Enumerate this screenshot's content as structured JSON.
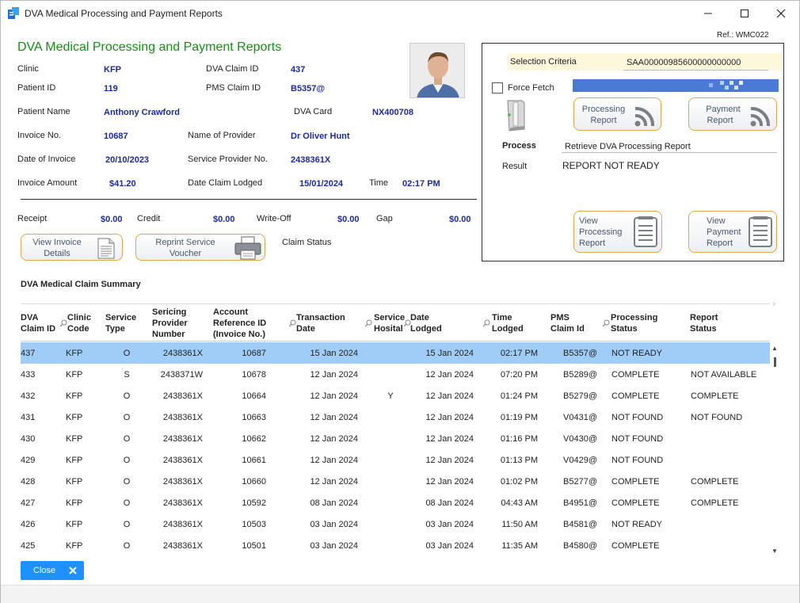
{
  "window": {
    "title": "DVA  Medical Processing and Payment Reports"
  },
  "header": {
    "title": "DVA  Medical Processing and Payment Reports",
    "ref": "Ref.: WMC022"
  },
  "claim": {
    "clinic_label": "Clinic",
    "clinic": "KFP",
    "dva_claim_id_label": "DVA Claim ID",
    "dva_claim_id": "437",
    "patient_id_label": "Patient ID",
    "patient_id": "119",
    "pms_claim_id_label": "PMS Claim ID",
    "pms_claim_id": "B5357@",
    "patient_name_label": "Patient Name",
    "patient_name": "Anthony Crawford",
    "dva_card_label": "DVA Card",
    "dva_card": "NX400708",
    "invoice_no_label": "Invoice No.",
    "invoice_no": "10687",
    "provider_name_label": "Name of Provider",
    "provider_name": "Dr Oliver Hunt",
    "date_of_invoice_label": "Date of Invoice",
    "date_of_invoice": "20/10/2023",
    "service_provider_no_label": "Service Provider No.",
    "service_provider_no": "2438361X",
    "invoice_amount_label": "Invoice Amount",
    "invoice_amount": "$41.20",
    "date_claim_lodged_label": "Date Claim Lodged",
    "date_claim_lodged": "15/01/2024",
    "time_label": "Time",
    "time": "02:17 PM"
  },
  "totals": {
    "receipt_label": "Receipt",
    "receipt": "$0.00",
    "credit_label": "Credit",
    "credit": "$0.00",
    "writeoff_label": "Write-Off",
    "writeoff": "$0.00",
    "gap_label": "Gap",
    "gap": "$0.00"
  },
  "buttons": {
    "view_invoice_1": "View Invoice",
    "view_invoice_2": "Details",
    "reprint_1": "Reprint Service",
    "reprint_2": "Voucher",
    "claim_status": "Claim Status",
    "processing_report_1": "Processing",
    "processing_report_2": "Report",
    "payment_report_1": "Payment",
    "payment_report_2": "Report",
    "view_processing_1": "View",
    "view_processing_2": "Processing",
    "view_processing_3": "Report",
    "view_payment_1": "View",
    "view_payment_2": "Payment",
    "view_payment_3": "Report",
    "close": "Close"
  },
  "panel": {
    "selection_criteria_label": "Selection Criteria",
    "selection_criteria": "SAA00000985600000000000",
    "force_fetch": "Force Fetch",
    "process_label": "Process",
    "process": "Retrieve DVA Processing Report",
    "result_label": "Result",
    "result": "REPORT NOT READY"
  },
  "summary": {
    "title": "DVA Medical Claim Summary",
    "columns": [
      [
        "DVA",
        "Claim ID"
      ],
      [
        "Clinic",
        "Code"
      ],
      [
        "Service",
        "Type"
      ],
      [
        "Sericing",
        "Provider",
        "Number"
      ],
      [
        "Account",
        "Reference ID",
        "(Invoice No.)"
      ],
      [
        "Transaction",
        "Date"
      ],
      [
        "Service",
        "Hosital"
      ],
      [
        "Date",
        "Lodged"
      ],
      [
        "Time",
        "Lodged"
      ],
      [
        "PMS",
        "Claim Id"
      ],
      [
        "Processing",
        "Status"
      ],
      [
        "Report",
        "Status"
      ]
    ],
    "rows": [
      [
        "437",
        "KFP",
        "O",
        "2438361X",
        "10687",
        "15 Jan 2024",
        "",
        "15 Jan 2024",
        "02:17 PM",
        "B5357@",
        "NOT READY",
        ""
      ],
      [
        "433",
        "KFP",
        "S",
        "2438371W",
        "10678",
        "12 Jan 2024",
        "",
        "12 Jan 2024",
        "07:20 PM",
        "B5289@",
        "COMPLETE",
        "NOT AVAILABLE"
      ],
      [
        "432",
        "KFP",
        "O",
        "2438361X",
        "10664",
        "12 Jan 2024",
        "Y",
        "12 Jan 2024",
        "01:24 PM",
        "B5279@",
        "COMPLETE",
        "COMPLETE"
      ],
      [
        "431",
        "KFP",
        "O",
        "2438361X",
        "10663",
        "12 Jan 2024",
        "",
        "12 Jan 2024",
        "01:19 PM",
        "V0431@",
        "NOT FOUND",
        "NOT FOUND"
      ],
      [
        "430",
        "KFP",
        "O",
        "2438361X",
        "10662",
        "12 Jan 2024",
        "",
        "12 Jan 2024",
        "01:16 PM",
        "V0430@",
        "NOT FOUND",
        ""
      ],
      [
        "429",
        "KFP",
        "O",
        "2438361X",
        "10661",
        "12 Jan 2024",
        "",
        "12 Jan 2024",
        "01:13 PM",
        "V0429@",
        "NOT FOUND",
        ""
      ],
      [
        "428",
        "KFP",
        "O",
        "2438361X",
        "10660",
        "12 Jan 2024",
        "",
        "12 Jan 2024",
        "01:02 PM",
        "B5277@",
        "COMPLETE",
        "COMPLETE"
      ],
      [
        "427",
        "KFP",
        "O",
        "2438361X",
        "10592",
        "08 Jan 2024",
        "",
        "08 Jan 2024",
        "04:43 AM",
        "B4951@",
        "COMPLETE",
        "COMPLETE"
      ],
      [
        "426",
        "KFP",
        "O",
        "2438361X",
        "10503",
        "03 Jan 2024",
        "",
        "03 Jan 2024",
        "11:50 AM",
        "B4581@",
        "NOT READY",
        ""
      ],
      [
        "425",
        "KFP",
        "O",
        "2438361X",
        "10501",
        "03 Jan 2024",
        "",
        "03 Jan 2024",
        "11:35 AM",
        "B4580@",
        "COMPLETE",
        ""
      ]
    ]
  },
  "colors": {
    "heading": "#1a8a1a",
    "value": "#1b2a9c",
    "selected_row": "#9fcdf7",
    "button_border": "#d9a94a",
    "close_button": "#1e90ff"
  }
}
